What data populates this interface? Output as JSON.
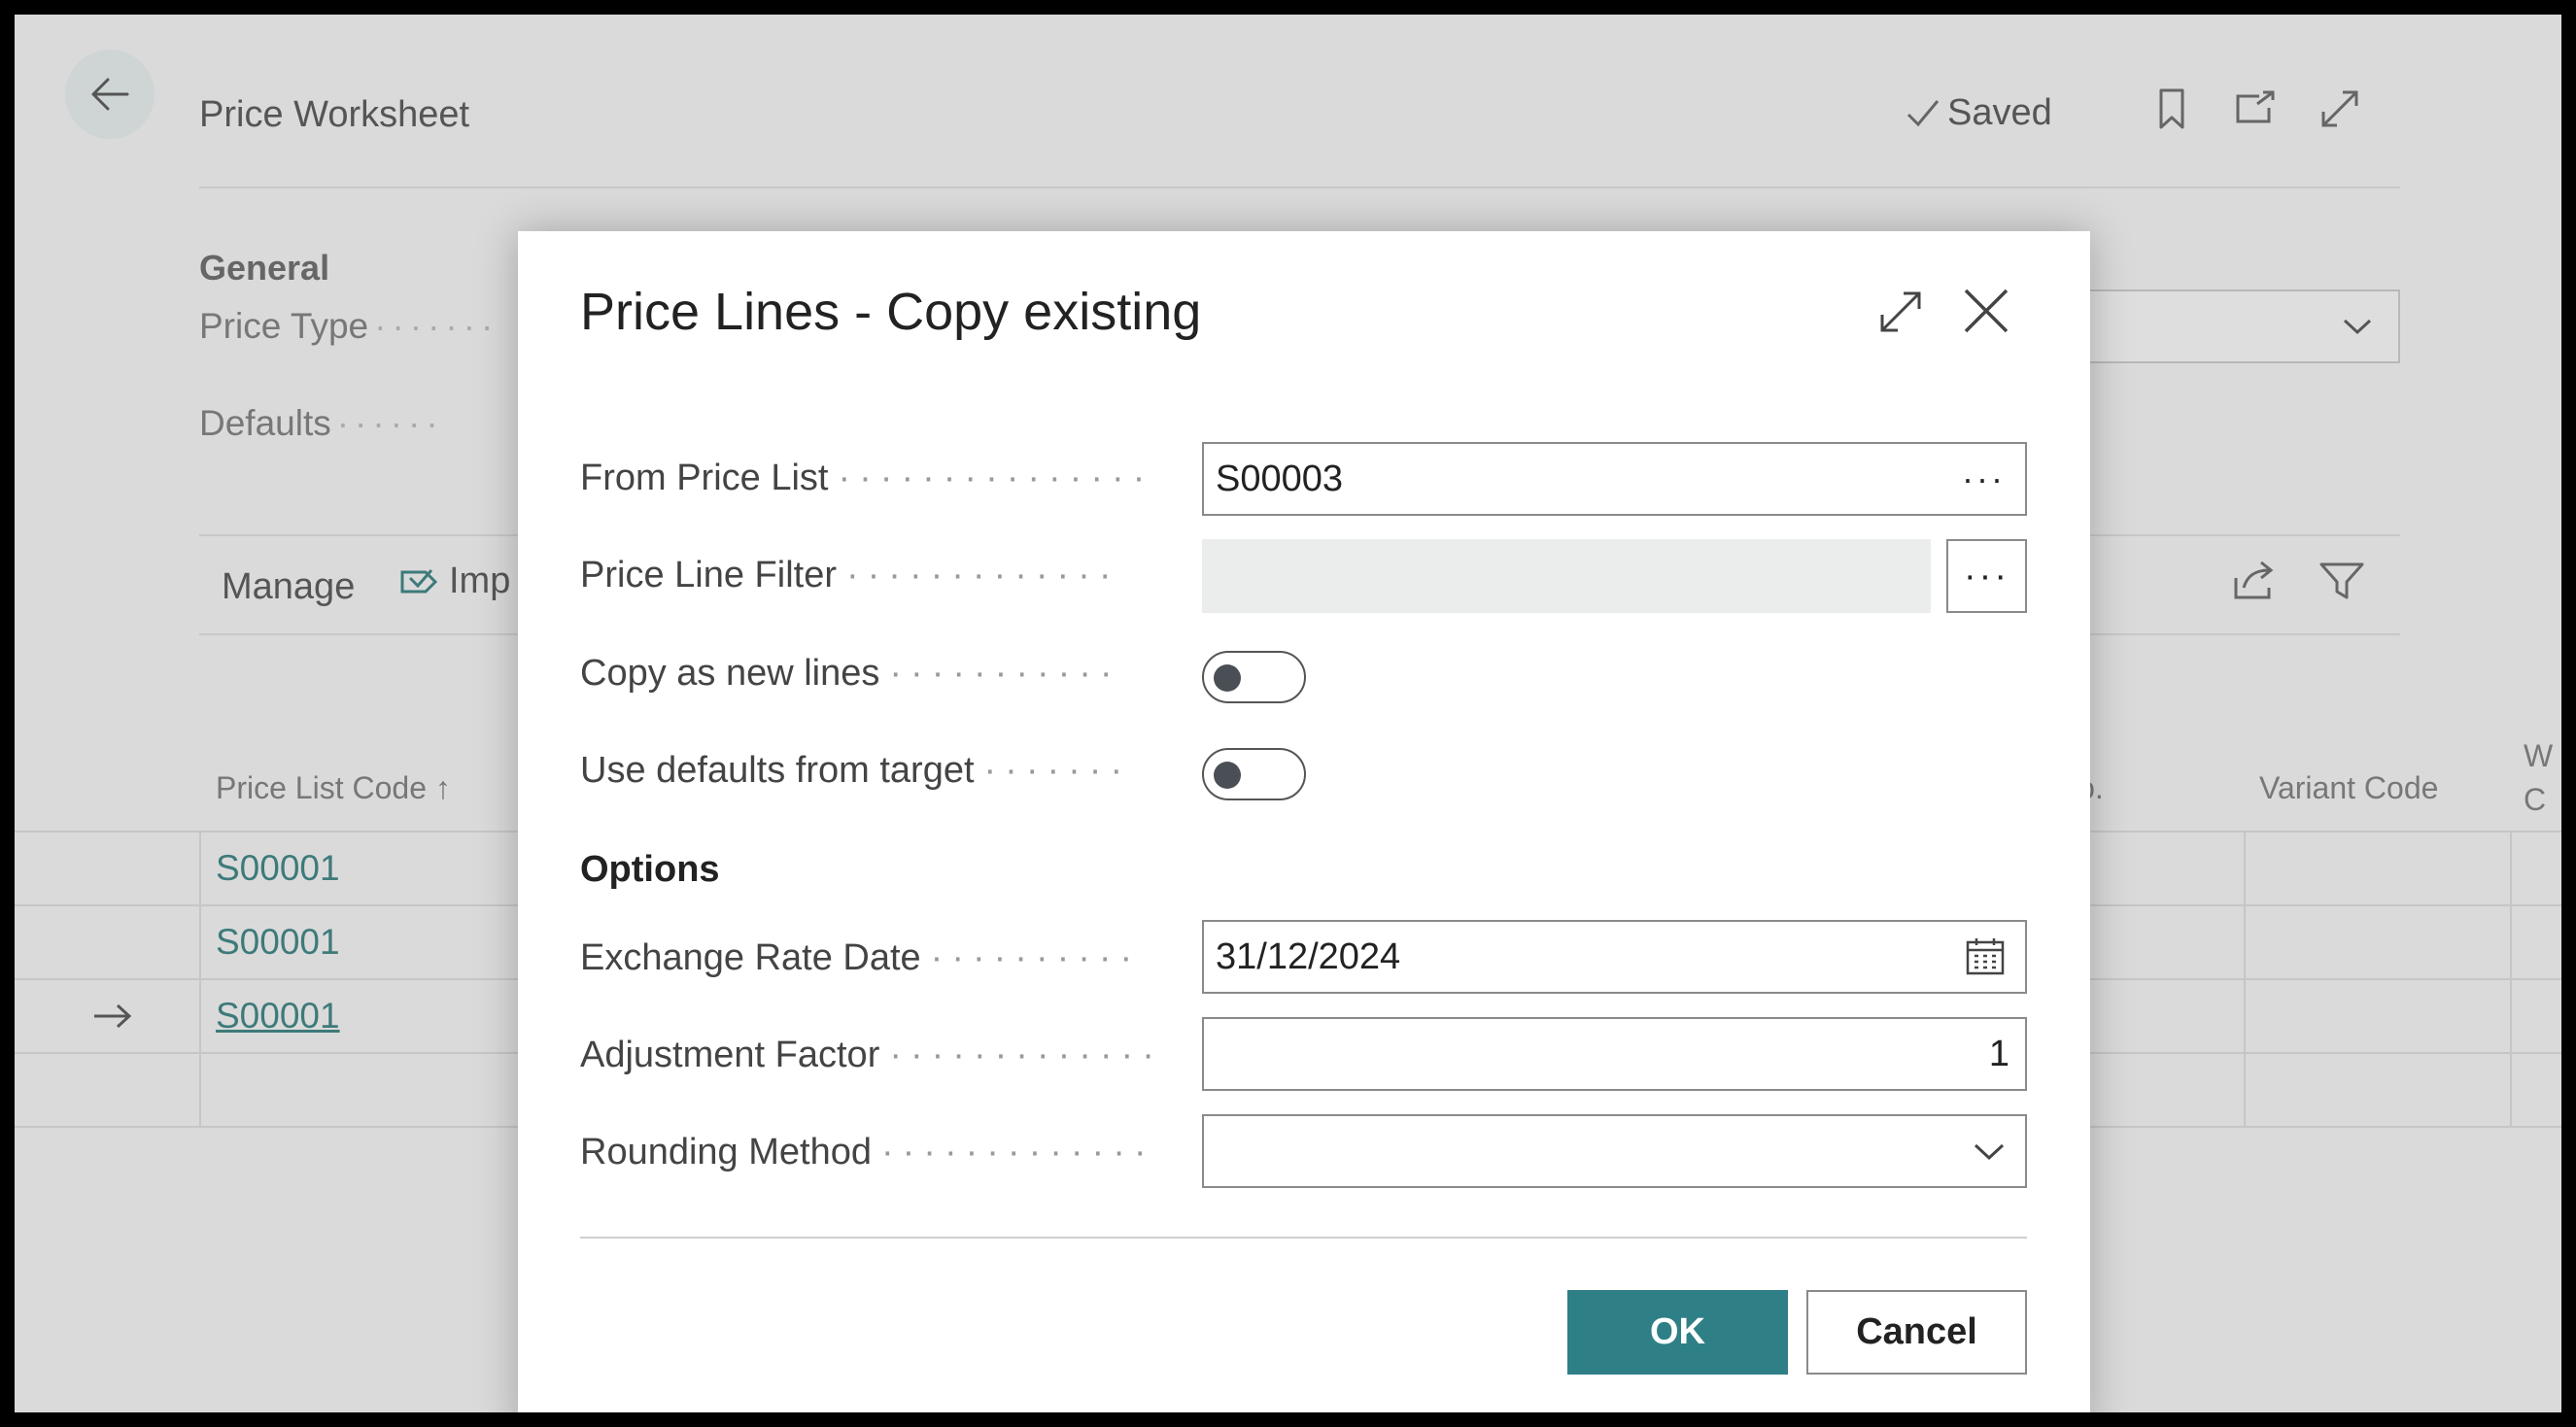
{
  "header": {
    "title": "Price Worksheet",
    "saved_label": "Saved"
  },
  "background": {
    "section_title": "General",
    "fields": [
      "Price Type",
      "Defaults"
    ],
    "actions": {
      "manage": "Manage",
      "import": "Imp"
    },
    "columns": {
      "price_list_code": "Price List Code",
      "no": "No.",
      "variant_code": "Variant Code",
      "partial_w": "W",
      "partial_c": "C"
    },
    "rows": [
      "S00001",
      "S00001",
      "S00001"
    ]
  },
  "dialog": {
    "title": "Price Lines - Copy existing",
    "fields": {
      "from_price_list": {
        "label": "From Price List",
        "value": "S00003"
      },
      "price_line_filter": {
        "label": "Price Line Filter",
        "value": ""
      },
      "copy_as_new_lines": {
        "label": "Copy as new lines",
        "on": false
      },
      "use_defaults": {
        "label": "Use defaults from target",
        "on": false
      }
    },
    "options_title": "Options",
    "options": {
      "exchange_rate_date": {
        "label": "Exchange Rate Date",
        "value": "31/12/2024"
      },
      "adjustment_factor": {
        "label": "Adjustment Factor",
        "value": "1"
      },
      "rounding_method": {
        "label": "Rounding Method",
        "value": ""
      }
    },
    "ok_label": "OK",
    "cancel_label": "Cancel",
    "ellipsis": "···"
  },
  "colors": {
    "accent": "#2f7f86",
    "link": "#3e7a7a",
    "backdrop": "#dadada"
  }
}
